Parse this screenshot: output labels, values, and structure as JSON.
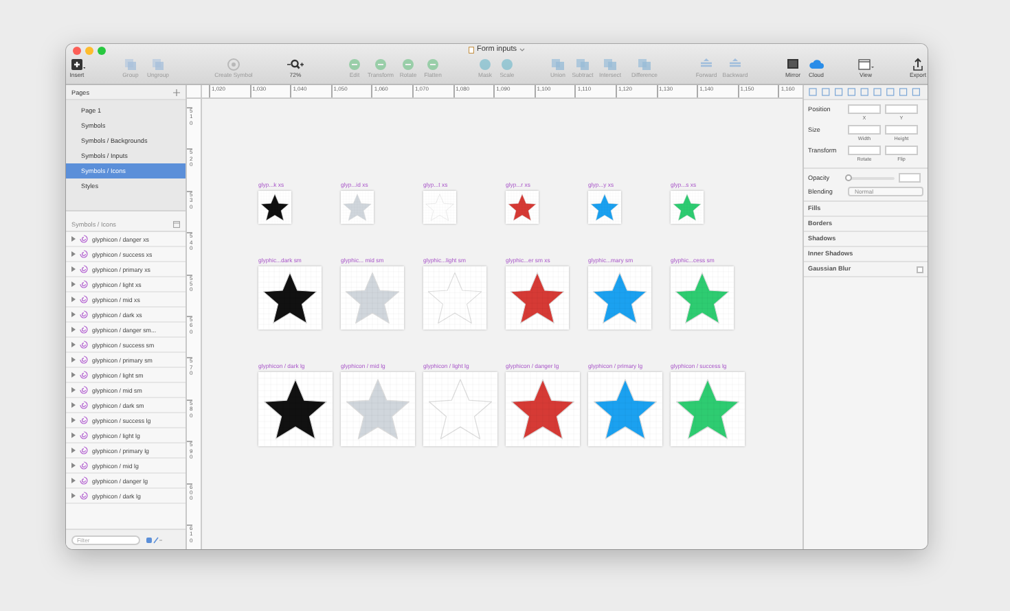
{
  "window": {
    "title": "Form inputs"
  },
  "toolbar": [
    {
      "label": "Insert",
      "disabled": false
    },
    {
      "label": "Group",
      "disabled": true
    },
    {
      "label": "Ungroup",
      "disabled": true
    },
    {
      "label": "Create Symbol",
      "disabled": true
    },
    {
      "label": "72%",
      "disabled": false
    },
    {
      "label": "Edit",
      "disabled": true
    },
    {
      "label": "Transform",
      "disabled": true
    },
    {
      "label": "Rotate",
      "disabled": true
    },
    {
      "label": "Flatten",
      "disabled": true
    },
    {
      "label": "Mask",
      "disabled": true
    },
    {
      "label": "Scale",
      "disabled": true
    },
    {
      "label": "Union",
      "disabled": true
    },
    {
      "label": "Subtract",
      "disabled": true
    },
    {
      "label": "Intersect",
      "disabled": true
    },
    {
      "label": "Difference",
      "disabled": true
    },
    {
      "label": "Forward",
      "disabled": true
    },
    {
      "label": "Backward",
      "disabled": true
    },
    {
      "label": "Mirror",
      "disabled": false
    },
    {
      "label": "Cloud",
      "disabled": false
    },
    {
      "label": "View",
      "disabled": false
    },
    {
      "label": "Export",
      "disabled": false
    }
  ],
  "pages": {
    "title": "Pages",
    "items": [
      {
        "label": "Page 1",
        "selected": false
      },
      {
        "label": "Symbols",
        "selected": false
      },
      {
        "label": "Symbols / Backgrounds",
        "selected": false
      },
      {
        "label": "Symbols / Inputs",
        "selected": false
      },
      {
        "label": "Symbols / Icons",
        "selected": true
      },
      {
        "label": "Styles",
        "selected": false
      }
    ]
  },
  "layers": {
    "title": "Symbols / Icons",
    "items": [
      "glyphicon / danger xs",
      "glyphicon / success xs",
      "glyphicon / primary xs",
      "glyphicon / light xs",
      "glyphicon / mid xs",
      "glyphicon / dark xs",
      "glyphicon / danger sm...",
      "glyphicon / success sm",
      "glyphicon / primary sm",
      "glyphicon / light sm",
      "glyphicon / mid sm",
      "glyphicon / dark sm",
      "glyphicon / success lg",
      "glyphicon / light lg",
      "glyphicon / primary lg",
      "glyphicon / mid lg",
      "glyphicon / danger lg",
      "glyphicon / dark lg"
    ],
    "filter_placeholder": "Filter"
  },
  "rulers": {
    "horizontal": [
      "1,020",
      "1,030",
      "1,040",
      "1,050",
      "1,060",
      "1,070",
      "1,080",
      "1,090",
      "1,100",
      "1,110",
      "1,120",
      "1,130",
      "1,140",
      "1,150",
      "1,160"
    ],
    "vertical": [
      "510",
      "520",
      "530",
      "540",
      "550",
      "560",
      "570",
      "580",
      "590",
      "600",
      "610"
    ]
  },
  "canvas": {
    "rows": [
      {
        "kind": "xs",
        "artboards": [
          {
            "label": "glyp...k xs",
            "color": "#111111"
          },
          {
            "label": "glyp...id xs",
            "color": "#d0d6dc"
          },
          {
            "label": "glyp...t xs",
            "color": "#ffffff"
          },
          {
            "label": "glyp...r xs",
            "color": "#d63a35"
          },
          {
            "label": "glyp...y xs",
            "color": "#1ba1f0"
          },
          {
            "label": "glyp...s xs",
            "color": "#2ecc71"
          }
        ]
      },
      {
        "kind": "sm",
        "artboards": [
          {
            "label": "glyphic...dark sm",
            "color": "#111111"
          },
          {
            "label": "glyphic... mid sm",
            "color": "#d0d6dc"
          },
          {
            "label": "glyphic...light sm",
            "color": "#ffffff"
          },
          {
            "label": "glyphic...er sm xs",
            "color": "#d63a35"
          },
          {
            "label": "glyphic...mary sm",
            "color": "#1ba1f0"
          },
          {
            "label": "glyphic...cess sm",
            "color": "#2ecc71"
          }
        ]
      },
      {
        "kind": "lg",
        "artboards": [
          {
            "label": "glyphicon / dark lg",
            "color": "#111111"
          },
          {
            "label": "glyphicon / mid lg",
            "color": "#d0d6dc"
          },
          {
            "label": "glyphicon / light lg",
            "color": "#ffffff"
          },
          {
            "label": "glyphicon / danger lg",
            "color": "#d63a35"
          },
          {
            "label": "glyphicon / primary lg",
            "color": "#1ba1f0"
          },
          {
            "label": "glyphicon / success lg",
            "color": "#2ecc71"
          }
        ]
      }
    ]
  },
  "inspector": {
    "position": {
      "label": "Position",
      "fields": [
        "X",
        "Y"
      ]
    },
    "size": {
      "label": "Size",
      "fields": [
        "Width",
        "Height"
      ]
    },
    "transform": {
      "label": "Transform",
      "fields": [
        "Rotate",
        "Flip"
      ]
    },
    "opacity": {
      "label": "Opacity",
      "level": 0
    },
    "blending": {
      "label": "Blending",
      "value": "Normal"
    },
    "sections": [
      "Fills",
      "Borders",
      "Shadows",
      "Inner Shadows"
    ],
    "gaussian_blur": {
      "label": "Gaussian Blur",
      "checked": false
    }
  }
}
